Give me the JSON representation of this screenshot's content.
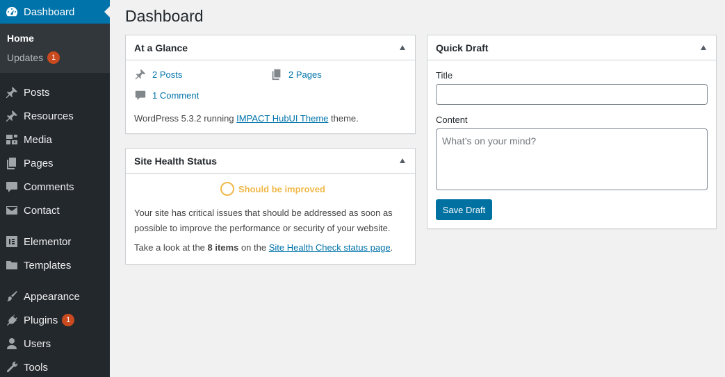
{
  "sidebar": {
    "dashboard": "Dashboard",
    "submenu": {
      "home": "Home",
      "updates": "Updates",
      "updates_badge": "1"
    },
    "items": [
      {
        "label": "Posts",
        "icon": "pin-icon"
      },
      {
        "label": "Resources",
        "icon": "pin-icon"
      },
      {
        "label": "Media",
        "icon": "media-icon"
      },
      {
        "label": "Pages",
        "icon": "pages-icon"
      },
      {
        "label": "Comments",
        "icon": "comment-icon"
      },
      {
        "label": "Contact",
        "icon": "envelope-icon"
      },
      {
        "label": "Elementor",
        "icon": "elementor-icon"
      },
      {
        "label": "Templates",
        "icon": "folder-icon"
      },
      {
        "label": "Appearance",
        "icon": "brush-icon"
      },
      {
        "label": "Plugins",
        "icon": "plug-icon",
        "badge": "1"
      },
      {
        "label": "Users",
        "icon": "user-icon"
      },
      {
        "label": "Tools",
        "icon": "wrench-icon"
      }
    ]
  },
  "main": {
    "title": "Dashboard",
    "glance": {
      "title": "At a Glance",
      "posts": "2 Posts",
      "pages": "2 Pages",
      "comments": "1 Comment",
      "version_prefix": "WordPress 5.3.2 running ",
      "theme_link": "IMPACT HubUI Theme",
      "version_suffix": " theme."
    },
    "health": {
      "title": "Site Health Status",
      "status": "Should be improved",
      "description": "Your site has critical issues that should be addressed as soon as possible to improve the performance or security of your website.",
      "take_prefix": "Take a look at the ",
      "items_bold": "8 items",
      "take_middle": " on the ",
      "link": "Site Health Check status page",
      "take_suffix": "."
    },
    "quick_draft": {
      "title": "Quick Draft",
      "title_label": "Title",
      "title_value": "",
      "content_label": "Content",
      "content_placeholder": "What’s on your mind?",
      "save_label": "Save Draft"
    }
  },
  "colors": {
    "sidebar_bg": "#23282d",
    "accent": "#0073aa",
    "badge": "#ca4a1f",
    "health_warning": "#f0b849"
  }
}
